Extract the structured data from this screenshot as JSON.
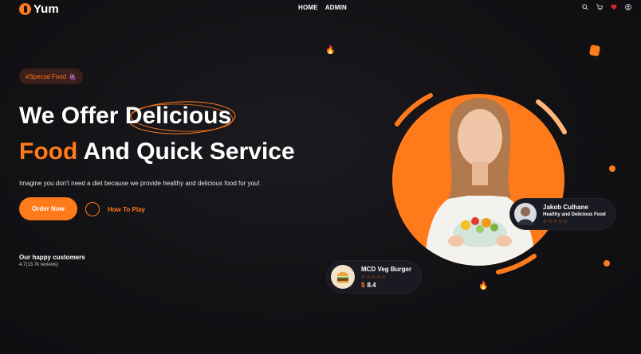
{
  "header": {
    "logo_text": "Yum",
    "nav": [
      "HOME",
      "ADMIN"
    ],
    "icons": [
      "search-icon",
      "cart-icon",
      "heart-icon",
      "user-icon"
    ]
  },
  "hero": {
    "badge": "#Special Food",
    "badge_icon": "🍇",
    "title_line1_a": "We Offer ",
    "title_line1_b": "Delicious",
    "title_line2_a": "Food",
    "title_line2_b": " And Quick Service",
    "description": "Imagine you don't need a diet because we provide healthy and delicious food for you!.",
    "order_button": "Order Now",
    "play_label": "How To Play",
    "happy_title": "Our happy customers",
    "happy_sub": "4.7(13.7k reviews)"
  },
  "cards": {
    "person": {
      "name": "Jakob Culhane",
      "subtitle": "Healthy and Delicious Food",
      "stars": "☆☆☆☆☆"
    },
    "product": {
      "name": "MCD Veg Burger",
      "stars": "☆☆☆☆☆",
      "currency": "$",
      "price": "8.4"
    }
  },
  "colors": {
    "accent": "#ff7a1a",
    "background": "#121114",
    "card": "#1a1b22"
  }
}
